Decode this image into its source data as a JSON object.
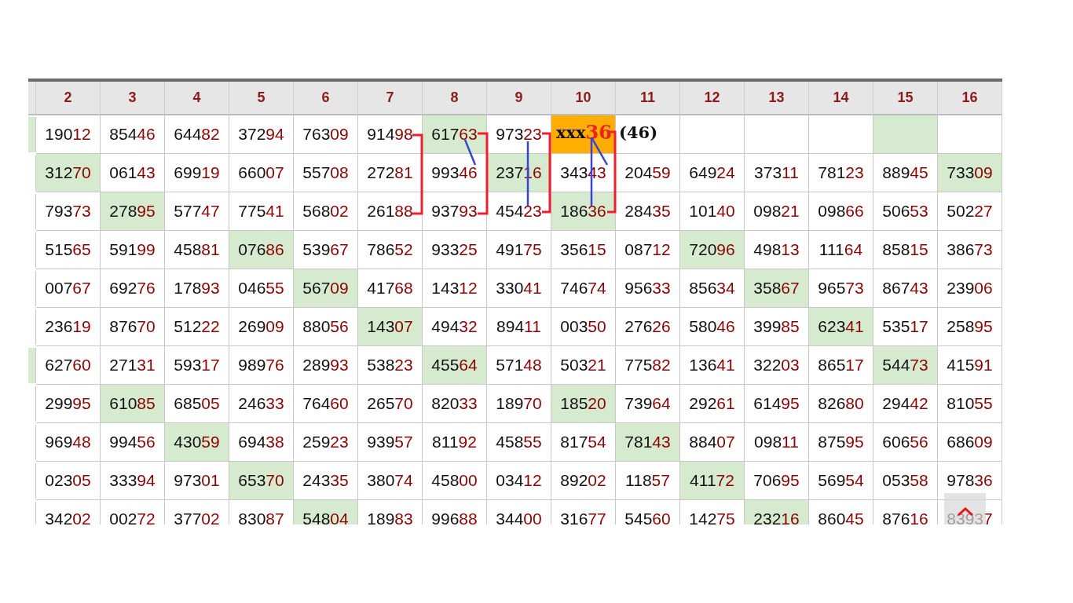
{
  "header": {
    "columns": [
      "2",
      "3",
      "4",
      "5",
      "6",
      "7",
      "8",
      "9",
      "10",
      "11",
      "12",
      "13",
      "14",
      "15",
      "16"
    ]
  },
  "rows": [
    {
      "edge_highlighted": true,
      "cells": [
        {
          "kind": "number",
          "head": "190",
          "tail": "12",
          "highlighted": false
        },
        {
          "kind": "number",
          "head": "854",
          "tail": "46",
          "highlighted": false
        },
        {
          "kind": "number",
          "head": "644",
          "tail": "82",
          "highlighted": false
        },
        {
          "kind": "number",
          "head": "372",
          "tail": "94",
          "highlighted": false
        },
        {
          "kind": "number",
          "head": "763",
          "tail": "09",
          "highlighted": false
        },
        {
          "kind": "number",
          "head": "914",
          "tail": "98",
          "highlighted": false
        },
        {
          "kind": "number",
          "head": "617",
          "tail": "63",
          "highlighted": true
        },
        {
          "kind": "number",
          "head": "973",
          "tail": "23",
          "highlighted": false
        },
        {
          "kind": "target",
          "head": "xxx",
          "tail": "36"
        },
        {
          "kind": "note",
          "head": "(46)"
        },
        {
          "kind": "empty",
          "highlighted": false
        },
        {
          "kind": "empty",
          "highlighted": false
        },
        {
          "kind": "empty",
          "highlighted": false
        },
        {
          "kind": "empty",
          "highlighted": true
        },
        {
          "kind": "empty",
          "highlighted": false
        }
      ]
    },
    {
      "edge_highlighted": false,
      "cells": [
        {
          "kind": "number",
          "head": "312",
          "tail": "70",
          "highlighted": true
        },
        {
          "kind": "number",
          "head": "061",
          "tail": "43",
          "highlighted": false
        },
        {
          "kind": "number",
          "head": "699",
          "tail": "19",
          "highlighted": false
        },
        {
          "kind": "number",
          "head": "660",
          "tail": "07",
          "highlighted": false
        },
        {
          "kind": "number",
          "head": "557",
          "tail": "08",
          "highlighted": false
        },
        {
          "kind": "number",
          "head": "272",
          "tail": "81",
          "highlighted": false
        },
        {
          "kind": "number",
          "head": "993",
          "tail": "46",
          "highlighted": false
        },
        {
          "kind": "number",
          "head": "237",
          "tail": "16",
          "highlighted": true
        },
        {
          "kind": "number",
          "head": "343",
          "tail": "43",
          "highlighted": false
        },
        {
          "kind": "number",
          "head": "204",
          "tail": "59",
          "highlighted": false
        },
        {
          "kind": "number",
          "head": "649",
          "tail": "24",
          "highlighted": false
        },
        {
          "kind": "number",
          "head": "373",
          "tail": "11",
          "highlighted": false
        },
        {
          "kind": "number",
          "head": "781",
          "tail": "23",
          "highlighted": false
        },
        {
          "kind": "number",
          "head": "889",
          "tail": "45",
          "highlighted": false
        },
        {
          "kind": "number",
          "head": "733",
          "tail": "09",
          "highlighted": true
        }
      ]
    },
    {
      "edge_highlighted": false,
      "cells": [
        {
          "kind": "number",
          "head": "793",
          "tail": "73",
          "highlighted": false
        },
        {
          "kind": "number",
          "head": "278",
          "tail": "95",
          "highlighted": true
        },
        {
          "kind": "number",
          "head": "577",
          "tail": "47",
          "highlighted": false
        },
        {
          "kind": "number",
          "head": "775",
          "tail": "41",
          "highlighted": false
        },
        {
          "kind": "number",
          "head": "568",
          "tail": "02",
          "highlighted": false
        },
        {
          "kind": "number",
          "head": "261",
          "tail": "88",
          "highlighted": false
        },
        {
          "kind": "number",
          "head": "937",
          "tail": "93",
          "highlighted": false
        },
        {
          "kind": "number",
          "head": "454",
          "tail": "23",
          "highlighted": false
        },
        {
          "kind": "number",
          "head": "186",
          "tail": "36",
          "highlighted": true
        },
        {
          "kind": "number",
          "head": "284",
          "tail": "35",
          "highlighted": false
        },
        {
          "kind": "number",
          "head": "101",
          "tail": "40",
          "highlighted": false
        },
        {
          "kind": "number",
          "head": "098",
          "tail": "21",
          "highlighted": false
        },
        {
          "kind": "number",
          "head": "098",
          "tail": "66",
          "highlighted": false
        },
        {
          "kind": "number",
          "head": "506",
          "tail": "53",
          "highlighted": false
        },
        {
          "kind": "number",
          "head": "502",
          "tail": "27",
          "highlighted": false
        }
      ]
    },
    {
      "edge_highlighted": false,
      "cells": [
        {
          "kind": "number",
          "head": "515",
          "tail": "65",
          "highlighted": false
        },
        {
          "kind": "number",
          "head": "591",
          "tail": "99",
          "highlighted": false
        },
        {
          "kind": "number",
          "head": "458",
          "tail": "81",
          "highlighted": false
        },
        {
          "kind": "number",
          "head": "076",
          "tail": "86",
          "highlighted": true
        },
        {
          "kind": "number",
          "head": "539",
          "tail": "67",
          "highlighted": false
        },
        {
          "kind": "number",
          "head": "786",
          "tail": "52",
          "highlighted": false
        },
        {
          "kind": "number",
          "head": "933",
          "tail": "25",
          "highlighted": false
        },
        {
          "kind": "number",
          "head": "491",
          "tail": "75",
          "highlighted": false
        },
        {
          "kind": "number",
          "head": "356",
          "tail": "15",
          "highlighted": false
        },
        {
          "kind": "number",
          "head": "087",
          "tail": "12",
          "highlighted": false
        },
        {
          "kind": "number",
          "head": "720",
          "tail": "96",
          "highlighted": true
        },
        {
          "kind": "number",
          "head": "498",
          "tail": "13",
          "highlighted": false
        },
        {
          "kind": "number",
          "head": "111",
          "tail": "64",
          "highlighted": false
        },
        {
          "kind": "number",
          "head": "858",
          "tail": "15",
          "highlighted": false
        },
        {
          "kind": "number",
          "head": "386",
          "tail": "73",
          "highlighted": false
        }
      ]
    },
    {
      "edge_highlighted": false,
      "cells": [
        {
          "kind": "number",
          "head": "007",
          "tail": "67",
          "highlighted": false
        },
        {
          "kind": "number",
          "head": "692",
          "tail": "76",
          "highlighted": false
        },
        {
          "kind": "number",
          "head": "178",
          "tail": "93",
          "highlighted": false
        },
        {
          "kind": "number",
          "head": "046",
          "tail": "55",
          "highlighted": false
        },
        {
          "kind": "number",
          "head": "567",
          "tail": "09",
          "highlighted": true
        },
        {
          "kind": "number",
          "head": "417",
          "tail": "68",
          "highlighted": false
        },
        {
          "kind": "number",
          "head": "143",
          "tail": "12",
          "highlighted": false
        },
        {
          "kind": "number",
          "head": "330",
          "tail": "41",
          "highlighted": false
        },
        {
          "kind": "number",
          "head": "746",
          "tail": "74",
          "highlighted": false
        },
        {
          "kind": "number",
          "head": "956",
          "tail": "33",
          "highlighted": false
        },
        {
          "kind": "number",
          "head": "856",
          "tail": "34",
          "highlighted": false
        },
        {
          "kind": "number",
          "head": "358",
          "tail": "67",
          "highlighted": true
        },
        {
          "kind": "number",
          "head": "965",
          "tail": "73",
          "highlighted": false
        },
        {
          "kind": "number",
          "head": "867",
          "tail": "43",
          "highlighted": false
        },
        {
          "kind": "number",
          "head": "239",
          "tail": "06",
          "highlighted": false
        }
      ]
    },
    {
      "edge_highlighted": false,
      "cells": [
        {
          "kind": "number",
          "head": "236",
          "tail": "19",
          "highlighted": false
        },
        {
          "kind": "number",
          "head": "876",
          "tail": "70",
          "highlighted": false
        },
        {
          "kind": "number",
          "head": "512",
          "tail": "22",
          "highlighted": false
        },
        {
          "kind": "number",
          "head": "269",
          "tail": "09",
          "highlighted": false
        },
        {
          "kind": "number",
          "head": "880",
          "tail": "56",
          "highlighted": false
        },
        {
          "kind": "number",
          "head": "143",
          "tail": "07",
          "highlighted": true
        },
        {
          "kind": "number",
          "head": "494",
          "tail": "32",
          "highlighted": false
        },
        {
          "kind": "number",
          "head": "894",
          "tail": "11",
          "highlighted": false
        },
        {
          "kind": "number",
          "head": "003",
          "tail": "50",
          "highlighted": false
        },
        {
          "kind": "number",
          "head": "276",
          "tail": "26",
          "highlighted": false
        },
        {
          "kind": "number",
          "head": "580",
          "tail": "46",
          "highlighted": false
        },
        {
          "kind": "number",
          "head": "399",
          "tail": "85",
          "highlighted": false
        },
        {
          "kind": "number",
          "head": "623",
          "tail": "41",
          "highlighted": true
        },
        {
          "kind": "number",
          "head": "535",
          "tail": "17",
          "highlighted": false
        },
        {
          "kind": "number",
          "head": "258",
          "tail": "95",
          "highlighted": false
        }
      ]
    },
    {
      "edge_highlighted": true,
      "cells": [
        {
          "kind": "number",
          "head": "627",
          "tail": "60",
          "highlighted": false
        },
        {
          "kind": "number",
          "head": "271",
          "tail": "31",
          "highlighted": false
        },
        {
          "kind": "number",
          "head": "593",
          "tail": "17",
          "highlighted": false
        },
        {
          "kind": "number",
          "head": "989",
          "tail": "76",
          "highlighted": false
        },
        {
          "kind": "number",
          "head": "289",
          "tail": "93",
          "highlighted": false
        },
        {
          "kind": "number",
          "head": "538",
          "tail": "23",
          "highlighted": false
        },
        {
          "kind": "number",
          "head": "455",
          "tail": "64",
          "highlighted": true
        },
        {
          "kind": "number",
          "head": "571",
          "tail": "48",
          "highlighted": false
        },
        {
          "kind": "number",
          "head": "503",
          "tail": "21",
          "highlighted": false
        },
        {
          "kind": "number",
          "head": "775",
          "tail": "82",
          "highlighted": false
        },
        {
          "kind": "number",
          "head": "136",
          "tail": "41",
          "highlighted": false
        },
        {
          "kind": "number",
          "head": "322",
          "tail": "03",
          "highlighted": false
        },
        {
          "kind": "number",
          "head": "865",
          "tail": "17",
          "highlighted": false
        },
        {
          "kind": "number",
          "head": "544",
          "tail": "73",
          "highlighted": true
        },
        {
          "kind": "number",
          "head": "415",
          "tail": "91",
          "highlighted": false
        }
      ]
    },
    {
      "edge_highlighted": false,
      "cells": [
        {
          "kind": "number",
          "head": "299",
          "tail": "95",
          "highlighted": false
        },
        {
          "kind": "number",
          "head": "610",
          "tail": "85",
          "highlighted": true
        },
        {
          "kind": "number",
          "head": "685",
          "tail": "05",
          "highlighted": false
        },
        {
          "kind": "number",
          "head": "246",
          "tail": "33",
          "highlighted": false
        },
        {
          "kind": "number",
          "head": "764",
          "tail": "60",
          "highlighted": false
        },
        {
          "kind": "number",
          "head": "265",
          "tail": "70",
          "highlighted": false
        },
        {
          "kind": "number",
          "head": "820",
          "tail": "33",
          "highlighted": false
        },
        {
          "kind": "number",
          "head": "189",
          "tail": "70",
          "highlighted": false
        },
        {
          "kind": "number",
          "head": "185",
          "tail": "20",
          "highlighted": true
        },
        {
          "kind": "number",
          "head": "739",
          "tail": "64",
          "highlighted": false
        },
        {
          "kind": "number",
          "head": "292",
          "tail": "61",
          "highlighted": false
        },
        {
          "kind": "number",
          "head": "614",
          "tail": "95",
          "highlighted": false
        },
        {
          "kind": "number",
          "head": "826",
          "tail": "80",
          "highlighted": false
        },
        {
          "kind": "number",
          "head": "294",
          "tail": "42",
          "highlighted": false
        },
        {
          "kind": "number",
          "head": "810",
          "tail": "55",
          "highlighted": false
        }
      ]
    },
    {
      "edge_highlighted": false,
      "cells": [
        {
          "kind": "number",
          "head": "969",
          "tail": "48",
          "highlighted": false
        },
        {
          "kind": "number",
          "head": "994",
          "tail": "56",
          "highlighted": false
        },
        {
          "kind": "number",
          "head": "430",
          "tail": "59",
          "highlighted": true
        },
        {
          "kind": "number",
          "head": "694",
          "tail": "38",
          "highlighted": false
        },
        {
          "kind": "number",
          "head": "259",
          "tail": "23",
          "highlighted": false
        },
        {
          "kind": "number",
          "head": "939",
          "tail": "57",
          "highlighted": false
        },
        {
          "kind": "number",
          "head": "811",
          "tail": "92",
          "highlighted": false
        },
        {
          "kind": "number",
          "head": "458",
          "tail": "55",
          "highlighted": false
        },
        {
          "kind": "number",
          "head": "817",
          "tail": "54",
          "highlighted": false
        },
        {
          "kind": "number",
          "head": "781",
          "tail": "43",
          "highlighted": true
        },
        {
          "kind": "number",
          "head": "884",
          "tail": "07",
          "highlighted": false
        },
        {
          "kind": "number",
          "head": "098",
          "tail": "11",
          "highlighted": false
        },
        {
          "kind": "number",
          "head": "875",
          "tail": "95",
          "highlighted": false
        },
        {
          "kind": "number",
          "head": "606",
          "tail": "56",
          "highlighted": false
        },
        {
          "kind": "number",
          "head": "686",
          "tail": "09",
          "highlighted": false
        }
      ]
    },
    {
      "edge_highlighted": false,
      "cells": [
        {
          "kind": "number",
          "head": "023",
          "tail": "05",
          "highlighted": false
        },
        {
          "kind": "number",
          "head": "333",
          "tail": "94",
          "highlighted": false
        },
        {
          "kind": "number",
          "head": "973",
          "tail": "01",
          "highlighted": false
        },
        {
          "kind": "number",
          "head": "653",
          "tail": "70",
          "highlighted": true
        },
        {
          "kind": "number",
          "head": "243",
          "tail": "35",
          "highlighted": false
        },
        {
          "kind": "number",
          "head": "380",
          "tail": "74",
          "highlighted": false
        },
        {
          "kind": "number",
          "head": "458",
          "tail": "00",
          "highlighted": false
        },
        {
          "kind": "number",
          "head": "034",
          "tail": "12",
          "highlighted": false
        },
        {
          "kind": "number",
          "head": "892",
          "tail": "02",
          "highlighted": false
        },
        {
          "kind": "number",
          "head": "118",
          "tail": "57",
          "highlighted": false
        },
        {
          "kind": "number",
          "head": "411",
          "tail": "72",
          "highlighted": true
        },
        {
          "kind": "number",
          "head": "706",
          "tail": "95",
          "highlighted": false
        },
        {
          "kind": "number",
          "head": "569",
          "tail": "54",
          "highlighted": false
        },
        {
          "kind": "number",
          "head": "053",
          "tail": "58",
          "highlighted": false
        },
        {
          "kind": "number",
          "head": "978",
          "tail": "36",
          "highlighted": false
        }
      ]
    },
    {
      "edge_highlighted": false,
      "cells": [
        {
          "kind": "number",
          "head": "342",
          "tail": "02",
          "highlighted": false
        },
        {
          "kind": "number",
          "head": "002",
          "tail": "72",
          "highlighted": false
        },
        {
          "kind": "number",
          "head": "377",
          "tail": "02",
          "highlighted": false
        },
        {
          "kind": "number",
          "head": "830",
          "tail": "87",
          "highlighted": false
        },
        {
          "kind": "number",
          "head": "548",
          "tail": "04",
          "highlighted": true
        },
        {
          "kind": "number",
          "head": "189",
          "tail": "83",
          "highlighted": false
        },
        {
          "kind": "number",
          "head": "996",
          "tail": "88",
          "highlighted": false
        },
        {
          "kind": "number",
          "head": "344",
          "tail": "00",
          "highlighted": false
        },
        {
          "kind": "number",
          "head": "316",
          "tail": "77",
          "highlighted": false
        },
        {
          "kind": "number",
          "head": "545",
          "tail": "60",
          "highlighted": false
        },
        {
          "kind": "number",
          "head": "142",
          "tail": "75",
          "highlighted": false
        },
        {
          "kind": "number",
          "head": "232",
          "tail": "16",
          "highlighted": true
        },
        {
          "kind": "number",
          "head": "860",
          "tail": "45",
          "highlighted": false
        },
        {
          "kind": "number",
          "head": "876",
          "tail": "16",
          "highlighted": false
        },
        {
          "kind": "number",
          "head": "839",
          "tail": "37",
          "highlighted": false
        }
      ]
    }
  ]
}
